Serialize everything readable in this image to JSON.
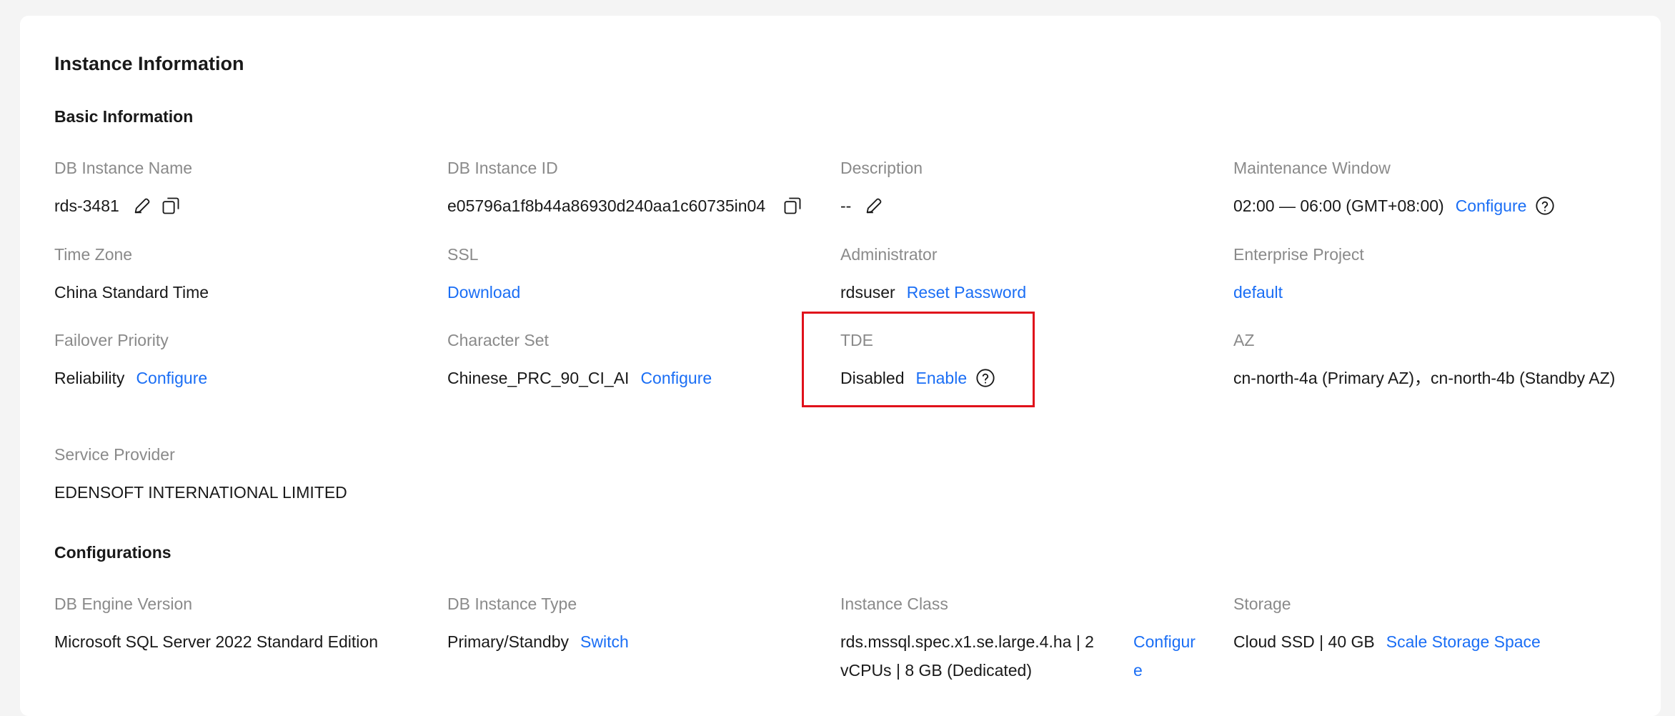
{
  "page": {
    "title": "Instance Information",
    "basic_section": "Basic Information",
    "config_section": "Configurations"
  },
  "basic": {
    "instance_name": {
      "label": "DB Instance Name",
      "value": "rds-3481"
    },
    "instance_id": {
      "label": "DB Instance ID",
      "value": "e05796a1f8b44a86930d240aa1c60735in04"
    },
    "description": {
      "label": "Description",
      "value": "--"
    },
    "maintenance": {
      "label": "Maintenance Window",
      "value": "02:00 — 06:00 (GMT+08:00)",
      "action": "Configure"
    },
    "time_zone": {
      "label": "Time Zone",
      "value": "China Standard Time"
    },
    "ssl": {
      "label": "SSL",
      "action": "Download"
    },
    "administrator": {
      "label": "Administrator",
      "value": "rdsuser",
      "action": "Reset Password"
    },
    "enterprise_project": {
      "label": "Enterprise Project",
      "value": "default"
    },
    "failover": {
      "label": "Failover Priority",
      "value": "Reliability",
      "action": "Configure"
    },
    "charset": {
      "label": "Character Set",
      "value": "Chinese_PRC_90_CI_AI",
      "action": "Configure"
    },
    "tde": {
      "label": "TDE",
      "value": "Disabled",
      "action": "Enable"
    },
    "az": {
      "label": "AZ",
      "value": "cn-north-4a (Primary AZ)，cn-north-4b (Standby AZ)"
    },
    "service_provider": {
      "label": "Service Provider",
      "value": "EDENSOFT INTERNATIONAL LIMITED"
    }
  },
  "config": {
    "engine": {
      "label": "DB Engine Version",
      "value": "Microsoft SQL Server 2022 Standard Edition"
    },
    "instance_type": {
      "label": "DB Instance Type",
      "value": "Primary/Standby",
      "action": "Switch"
    },
    "instance_class": {
      "label": "Instance Class",
      "value": "rds.mssql.spec.x1.se.large.4.ha | 2 vCPUs | 8 GB (Dedicated)",
      "action": "Configure"
    },
    "storage": {
      "label": "Storage",
      "value": "Cloud SSD | 40 GB",
      "action": "Scale Storage Space"
    }
  },
  "icons": [
    "edit-icon",
    "copy-icon",
    "help-icon"
  ],
  "colors": {
    "link": "#1a6ef5",
    "highlight": "#e0111b",
    "label": "#8a8a8a"
  }
}
